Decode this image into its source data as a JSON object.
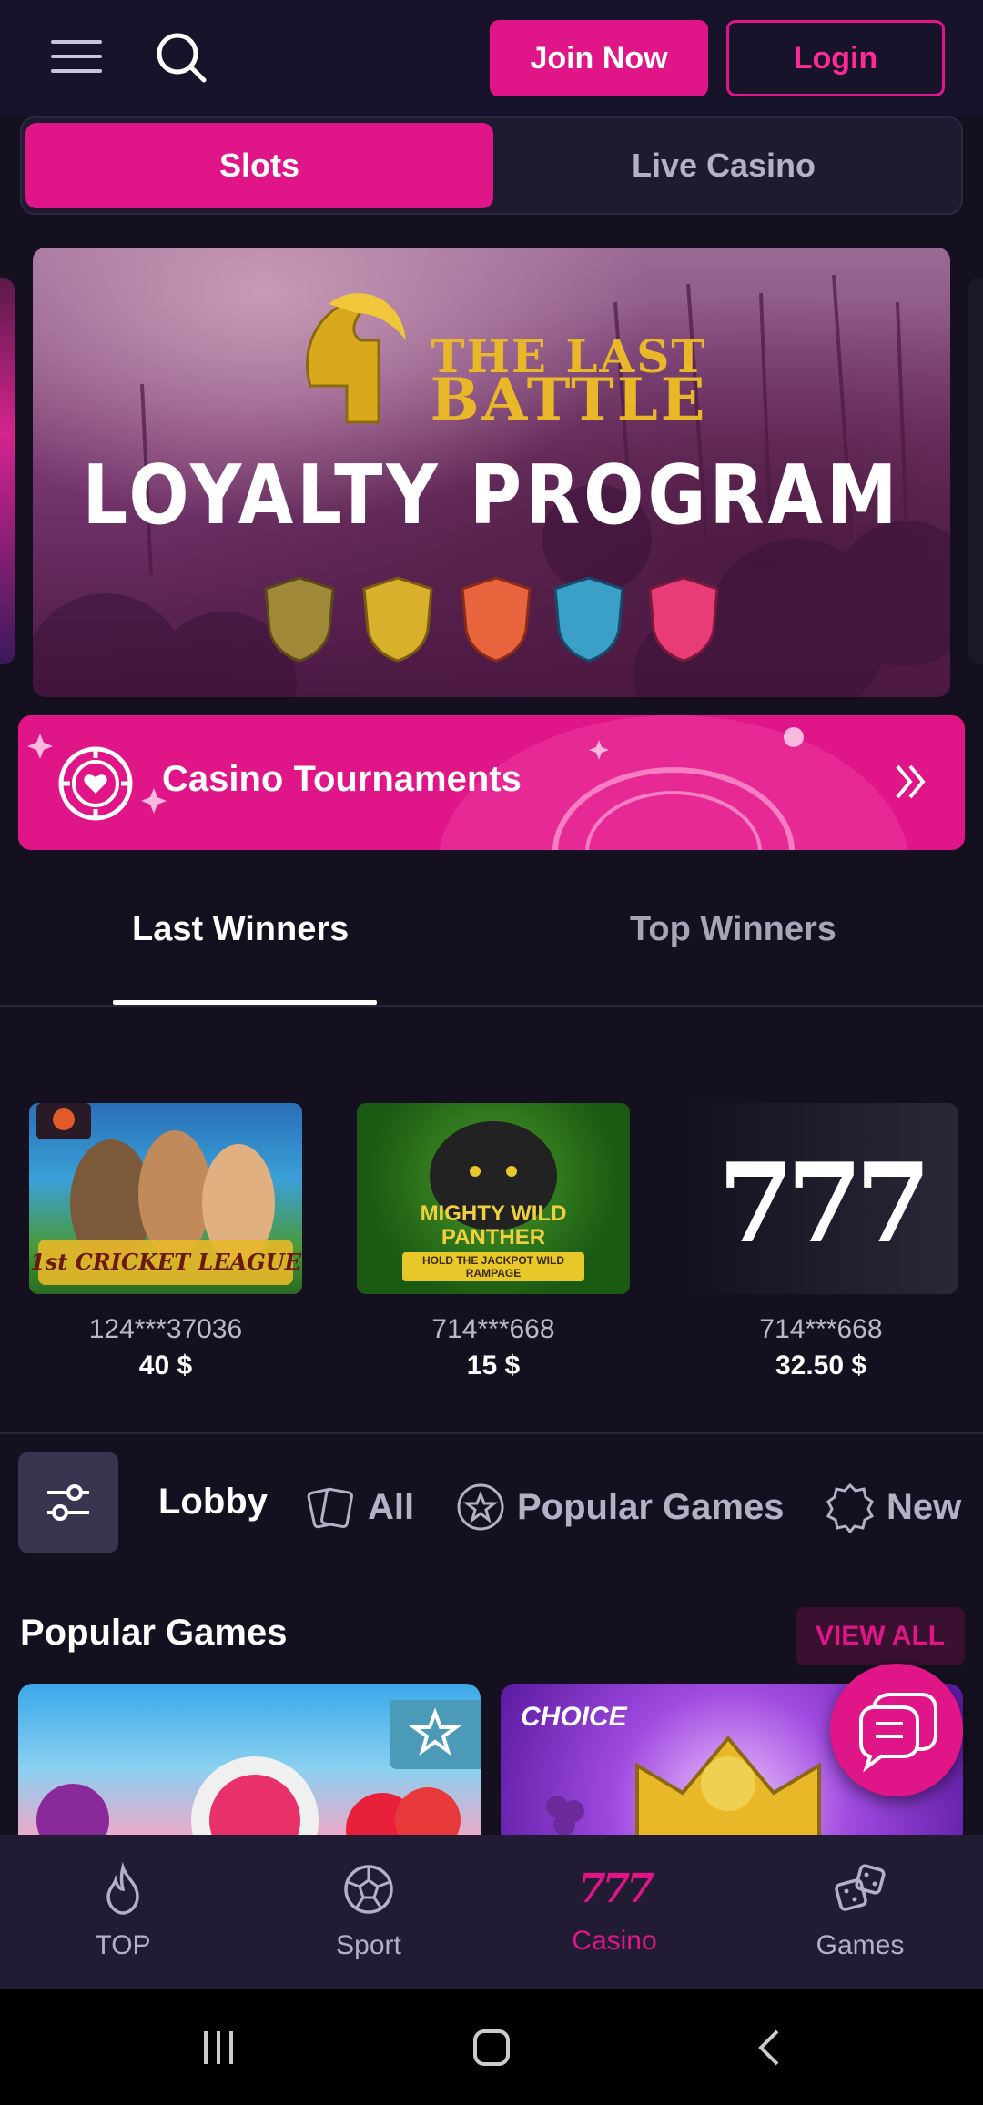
{
  "header": {
    "join_label": "Join Now",
    "login_label": "Login"
  },
  "mode_tabs": [
    {
      "label": "Slots",
      "active": true
    },
    {
      "label": "Live Casino",
      "active": false
    }
  ],
  "banner": {
    "title_line1": "THE LAST",
    "title_line2": "BATTLE",
    "subtitle": "LOYALTY PROGRAM",
    "shield_colors": [
      "#a08a3a",
      "#d9b02c",
      "#e8643c",
      "#3aa0c8",
      "#e83c78"
    ]
  },
  "tournaments": {
    "label": "Casino Tournaments"
  },
  "winners_tabs": [
    {
      "label": "Last Winners",
      "active": true
    },
    {
      "label": "Top Winners",
      "active": false
    }
  ],
  "winners": [
    {
      "user": "124***37036",
      "amount": "40 $",
      "game_art": "1st Cricket League"
    },
    {
      "user": "714***668",
      "amount": "15 $",
      "game_art": "Mighty Wild Panther"
    },
    {
      "user": "714***668",
      "amount": "32.50 $",
      "game_art": "777"
    }
  ],
  "winner_art_text": {
    "cricket": "1st CRICKET LEAGUE",
    "panther_top": "MIGHTY WILD",
    "panther_mid": "PANTHER",
    "panther_sub": "HOLD THE JACKPOT WILD RAMPAGE",
    "sevens": "777"
  },
  "filters": [
    {
      "label": "Lobby",
      "icon": "none"
    },
    {
      "label": "All",
      "icon": "cards-icon"
    },
    {
      "label": "Popular Games",
      "icon": "star-badge-icon"
    },
    {
      "label": "New",
      "icon": "new-badge-icon"
    }
  ],
  "popular": {
    "title": "Popular Games",
    "view_all": "VIEW ALL",
    "card2_brand": "CHOICE"
  },
  "bottom_nav": [
    {
      "label": "TOP",
      "icon": "flame-icon",
      "active": false
    },
    {
      "label": "Sport",
      "icon": "soccer-ball-icon",
      "active": false
    },
    {
      "label": "Casino",
      "icon": "777-icon",
      "active": true
    },
    {
      "label": "Games",
      "icon": "dice-icon",
      "active": false
    }
  ],
  "colors": {
    "accent": "#e01587",
    "background": "#141020",
    "nav_bg": "#211c33"
  }
}
